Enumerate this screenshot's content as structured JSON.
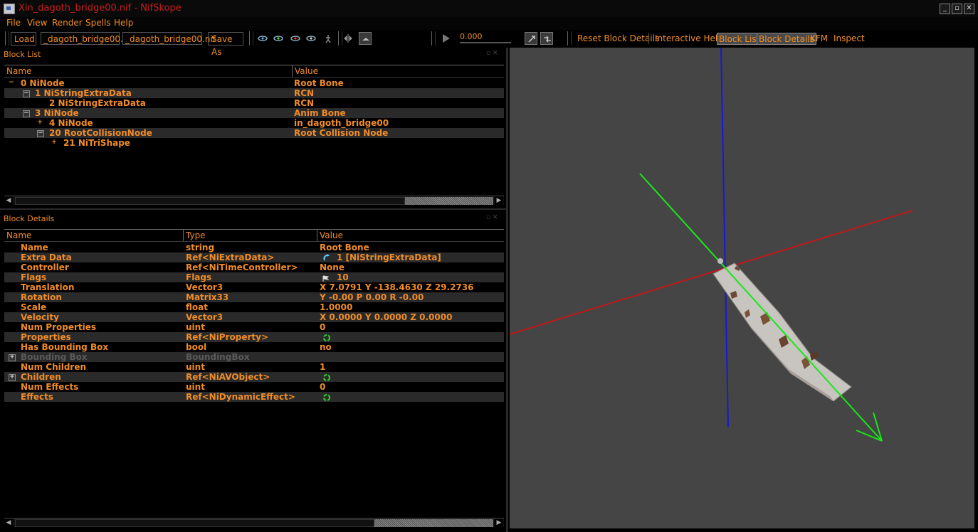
{
  "window": {
    "title": "Xin_dagoth_bridge00.nif - NifSkope"
  },
  "menu": [
    "File",
    "View",
    "Render",
    "Spells",
    "Help"
  ],
  "toolbar": {
    "load_label": "Load",
    "load_path": "_dagoth_bridge00.nif",
    "save_path": "_dagoth_bridge00.nif",
    "save_as_label": "Save As",
    "time_value": "0.000",
    "reset_label": "Reset Block Details",
    "help_label": "Interactive Help",
    "block_list_label": "Block List",
    "block_details_label": "Block Details",
    "kfm_label": "KFM",
    "inspect_label": "Inspect"
  },
  "block_list": {
    "title": "Block List",
    "columns": [
      "Name",
      "Value"
    ],
    "rows": [
      {
        "expander": "−",
        "name": "0 NiNode",
        "value": "Root Bone"
      },
      {
        "expander": "−",
        "name": "1 NiStringExtraData",
        "value": "RCN"
      },
      {
        "expander": "",
        "name": "2 NiStringExtraData",
        "value": "RCN"
      },
      {
        "expander": "−",
        "name": "3 NiNode",
        "value": "Anim Bone"
      },
      {
        "expander": "+",
        "name": "4 NiNode",
        "value": "in_dagoth_bridge00"
      },
      {
        "expander": "−",
        "name": "20 RootCollisionNode",
        "value": "Root Collision Node"
      },
      {
        "expander": "+",
        "name": "21 NiTriShape",
        "value": ""
      }
    ]
  },
  "block_details": {
    "title": "Block Details",
    "columns": [
      "Name",
      "Type",
      "Value"
    ],
    "rows": [
      {
        "name": "Name",
        "type": "string",
        "value": "Root Bone"
      },
      {
        "name": "Extra Data",
        "type": "Ref<NiExtraData>",
        "value": "1 [NiStringExtraData]"
      },
      {
        "name": "Controller",
        "type": "Ref<NiTimeController>",
        "value": "None"
      },
      {
        "name": "Flags",
        "type": "Flags",
        "value": "10"
      },
      {
        "name": "Translation",
        "type": "Vector3",
        "value": "X 7.0791 Y -138.4630 Z 29.2736"
      },
      {
        "name": "Rotation",
        "type": "Matrix33",
        "value": "Y -0.00 P 0.00 R -0.00"
      },
      {
        "name": "Scale",
        "type": "float",
        "value": "1.0000"
      },
      {
        "name": "Velocity",
        "type": "Vector3",
        "value": "X 0.0000 Y 0.0000 Z 0.0000"
      },
      {
        "name": "Num Properties",
        "type": "uint",
        "value": "0"
      },
      {
        "name": "Properties",
        "type": "Ref<NiProperty>",
        "value": ""
      },
      {
        "name": "Has Bounding Box",
        "type": "bool",
        "value": "no"
      },
      {
        "name": "Bounding Box",
        "type": "BoundingBox",
        "value": ""
      },
      {
        "name": "Num Children",
        "type": "uint",
        "value": "1"
      },
      {
        "name": "Children",
        "type": "Ref<NiAVObject>",
        "value": ""
      },
      {
        "name": "Num Effects",
        "type": "uint",
        "value": "0"
      },
      {
        "name": "Effects",
        "type": "Ref<NiDynamicEffect>",
        "value": ""
      }
    ]
  },
  "colors": {
    "accent": "#f08c28",
    "title_red": "#c81e1e",
    "viewport_bg": "#454545",
    "axis_x": "#c01818",
    "axis_y": "#18e818",
    "axis_z": "#1818d8"
  }
}
